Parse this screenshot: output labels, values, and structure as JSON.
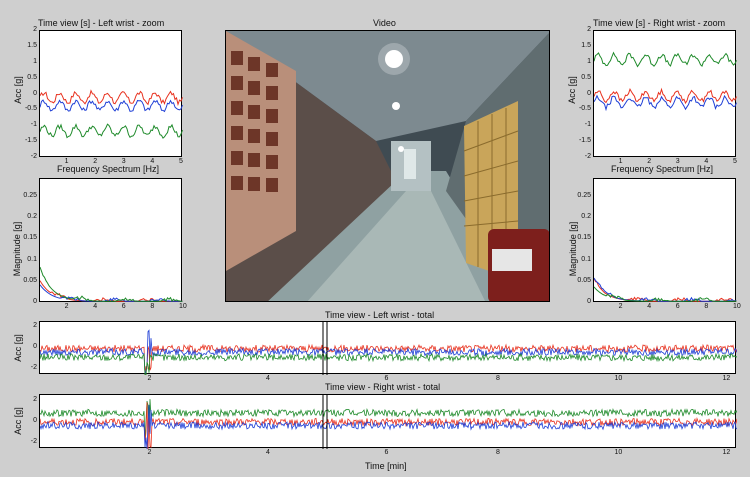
{
  "colors": {
    "red": "#e8321f",
    "green": "#1e8a2a",
    "blue": "#1f3fd6",
    "frame": "#cfcfcf"
  },
  "video": {
    "title": "Video"
  },
  "panels": {
    "left_zoom": {
      "title": "Time view [s] - Left wrist - zoom",
      "ylabel": "Acc [g]",
      "xlabel": "Frequency Spectrum [Hz]",
      "yticks": [
        "2",
        "1.5",
        "1",
        "0.5",
        "0",
        "-0.5",
        "-1",
        "-1.5",
        "-2"
      ],
      "xticks": [
        "1",
        "2",
        "3",
        "4",
        "5"
      ]
    },
    "right_zoom": {
      "title": "Time view [s] - Right wrist - zoom",
      "ylabel": "Acc [g]",
      "xlabel": "Frequency Spectrum [Hz]",
      "yticks": [
        "2",
        "1.5",
        "1",
        "0.5",
        "0",
        "-0.5",
        "-1",
        "-1.5",
        "-2"
      ],
      "xticks": [
        "1",
        "2",
        "3",
        "4",
        "5"
      ]
    },
    "left_spec": {
      "ylabel": "Magnitude [g]",
      "yticks": [
        "0.25",
        "0.2",
        "0.15",
        "0.1",
        "0.05",
        "0"
      ],
      "xticks": [
        "2",
        "4",
        "6",
        "8",
        "10"
      ]
    },
    "right_spec": {
      "ylabel": "Magnitude [g]",
      "yticks": [
        "0.25",
        "0.2",
        "0.15",
        "0.1",
        "0.05",
        "0"
      ],
      "xticks": [
        "2",
        "4",
        "6",
        "8",
        "10"
      ]
    },
    "left_total": {
      "title": "Time view - Left wrist - total",
      "ylabel": "Acc [g]",
      "yticks": [
        "2",
        "0",
        "-2"
      ],
      "xticks": [
        "2",
        "4",
        "6",
        "8",
        "10",
        "12"
      ]
    },
    "right_total": {
      "title": "Time view - Right wrist - total",
      "ylabel": "Acc [g]",
      "yticks": [
        "2",
        "0",
        "-2"
      ],
      "xticks": [
        "2",
        "4",
        "6",
        "8",
        "10",
        "12"
      ],
      "xlabel": "Time [min]"
    }
  },
  "chart_data": [
    {
      "type": "line",
      "title": "Time view [s] - Left wrist - zoom",
      "xlabel": "Frequency Spectrum [Hz]",
      "ylabel": "Acc [g]",
      "xlim": [
        0,
        5
      ],
      "ylim": [
        -2,
        2
      ],
      "series": [
        {
          "color": "red",
          "level": -0.1
        },
        {
          "color": "blue",
          "level": -0.35
        },
        {
          "color": "green",
          "level": -1.15
        }
      ]
    },
    {
      "type": "line",
      "title": "Time view [s] - Right wrist - zoom",
      "xlabel": "Frequency Spectrum [Hz]",
      "ylabel": "Acc [g]",
      "xlim": [
        0,
        5
      ],
      "ylim": [
        -2,
        2
      ],
      "series": [
        {
          "color": "green",
          "level": 1.1
        },
        {
          "color": "red",
          "level": -0.05
        },
        {
          "color": "blue",
          "level": -0.25
        }
      ]
    },
    {
      "type": "line",
      "ylabel": "Magnitude [g]",
      "xlim": [
        0,
        10
      ],
      "ylim": [
        0,
        0.3
      ],
      "series": [
        {
          "color": "red",
          "peak": 0.05
        },
        {
          "color": "blue",
          "peak": 0.04
        },
        {
          "color": "green",
          "peak": 0.08
        }
      ]
    },
    {
      "type": "line",
      "ylabel": "Magnitude [g]",
      "xlim": [
        0,
        10
      ],
      "ylim": [
        0,
        0.3
      ],
      "series": [
        {
          "color": "red",
          "peak": 0.05
        },
        {
          "color": "blue",
          "peak": 0.055
        },
        {
          "color": "green",
          "peak": 0.035
        }
      ]
    },
    {
      "type": "line",
      "title": "Time view - Left wrist - total",
      "ylabel": "Acc [g]",
      "xlim": [
        0.5,
        12.5
      ],
      "ylim": [
        -3,
        3
      ],
      "series": [
        {
          "color": "red",
          "level": 0
        },
        {
          "color": "blue",
          "level": -0.4
        },
        {
          "color": "green",
          "level": -1
        }
      ]
    },
    {
      "type": "line",
      "title": "Time view - Right wrist - total",
      "xlabel": "Time [min]",
      "ylabel": "Acc [g]",
      "xlim": [
        0.5,
        12.5
      ],
      "ylim": [
        -3,
        3
      ],
      "series": [
        {
          "color": "green",
          "level": 1
        },
        {
          "color": "red",
          "level": 0
        },
        {
          "color": "blue",
          "level": -0.4
        }
      ]
    }
  ]
}
